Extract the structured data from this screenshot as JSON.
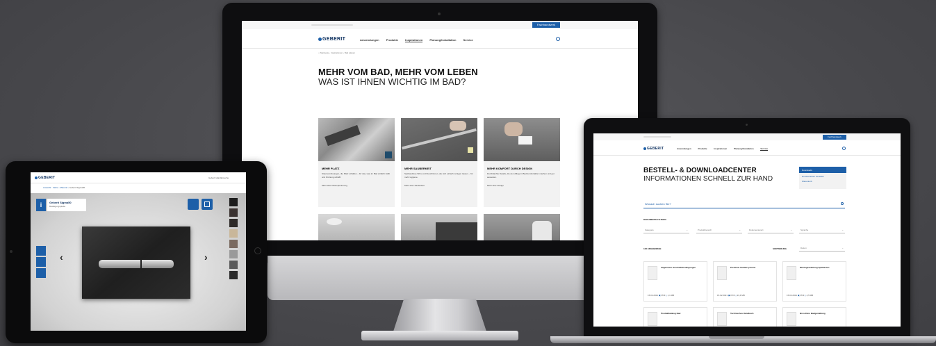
{
  "colors": {
    "background": "#48484c",
    "brand": "#0a2d5c",
    "accent": "#1d5fa8",
    "panel": "#f2f2f2"
  },
  "brand": {
    "logo": "GEBERIT"
  },
  "desktop": {
    "top_button": "Fachhandwerk",
    "nav": [
      "Anwendungen",
      "Produkte",
      "Inspirationen",
      "Planung/Installation",
      "Service"
    ],
    "breadcrumb": [
      "Startseite",
      "Inspirationen",
      "Bad planen"
    ],
    "headline": "MEHR VOM BAD, MEHR VOM LEBEN",
    "subheadline": "WAS IST IHNEN WICHTIG IM BAD?",
    "cards": [
      {
        "title": "MEHR PLATZ",
        "text": "Stauraumlösungen, die Platz schaffen – für das, was im Bad wirklich zählt und Ordnung schafft.",
        "link": "Mehr über Platzoptimierung"
      },
      {
        "title": "MEHR SAUBERKEIT",
        "text": "Spülrandlose WCs und Duschrinnen, die sich einfach reinigen lassen – für mehr Hygiene.",
        "link": "Mehr über Sauberkeit"
      },
      {
        "title": "MEHR KOMFORT DURCH DESIGN",
        "text": "Durchdachte Details, die den Alltag im Bad komfortabler machen und gut aussehen.",
        "link": "Mehr über Design"
      }
    ]
  },
  "laptop": {
    "top_button": "Fachhandwerk",
    "nav": [
      "Anwendungen",
      "Produkte",
      "Inspirationen",
      "Planung/Installation",
      "Service"
    ],
    "headline": "BESTELL- & DOWNLOADCENTER",
    "subheadline": "INFORMATIONEN SCHNELL ZUR HAND",
    "side_menu": [
      "Downloads",
      "Druckschriften bestellen",
      "Warenkorb"
    ],
    "search_placeholder": "Wonach suchen Sie?",
    "filter_title": "DOKUMENTE FILTERN",
    "filters": [
      "Kategorie",
      "Produktbereich",
      "Dokumentenart",
      "Sprache"
    ],
    "results_label": "126 ERGEBNISSE",
    "sort_label": "SORTIERUNG",
    "sort_value": "Datum",
    "docs": [
      {
        "title": "Allgemeine Geschäftsbedingungen",
        "date": "15.02.2021",
        "type": "PDF",
        "size": "1,1 MB"
      },
      {
        "title": "Preisliste Sanitärsysteme",
        "date": "15.02.2021",
        "type": "PDF",
        "size": "23,4 MB"
      },
      {
        "title": "Montageanleitung Spülkasten",
        "date": "15.02.2021",
        "type": "PDF",
        "size": "4,5 MB"
      },
      {
        "title": "Produktkatalog Bad",
        "date": "",
        "type": "",
        "size": ""
      },
      {
        "title": "Technisches Handbuch",
        "date": "",
        "type": "",
        "size": ""
      },
      {
        "title": "Broschüre Badgestaltung",
        "date": "",
        "type": "",
        "size": ""
      }
    ]
  },
  "tablet": {
    "top_link": "Geberit Händlersuche",
    "product_title": "Geberit Sigma50",
    "product_subtitle": "Betätigungsplatte",
    "breadcrumb": [
      "Auswahl",
      "Farbe",
      "Material",
      "Geberit Sigma50"
    ],
    "prev": "‹",
    "next": "›",
    "swatches": [
      "#1c1c1c",
      "#3a3230",
      "#2e2a28",
      "#c9b79a",
      "#7a6a60",
      "#9a9a9a",
      "#5a5a5a",
      "#2a2a2a"
    ]
  }
}
